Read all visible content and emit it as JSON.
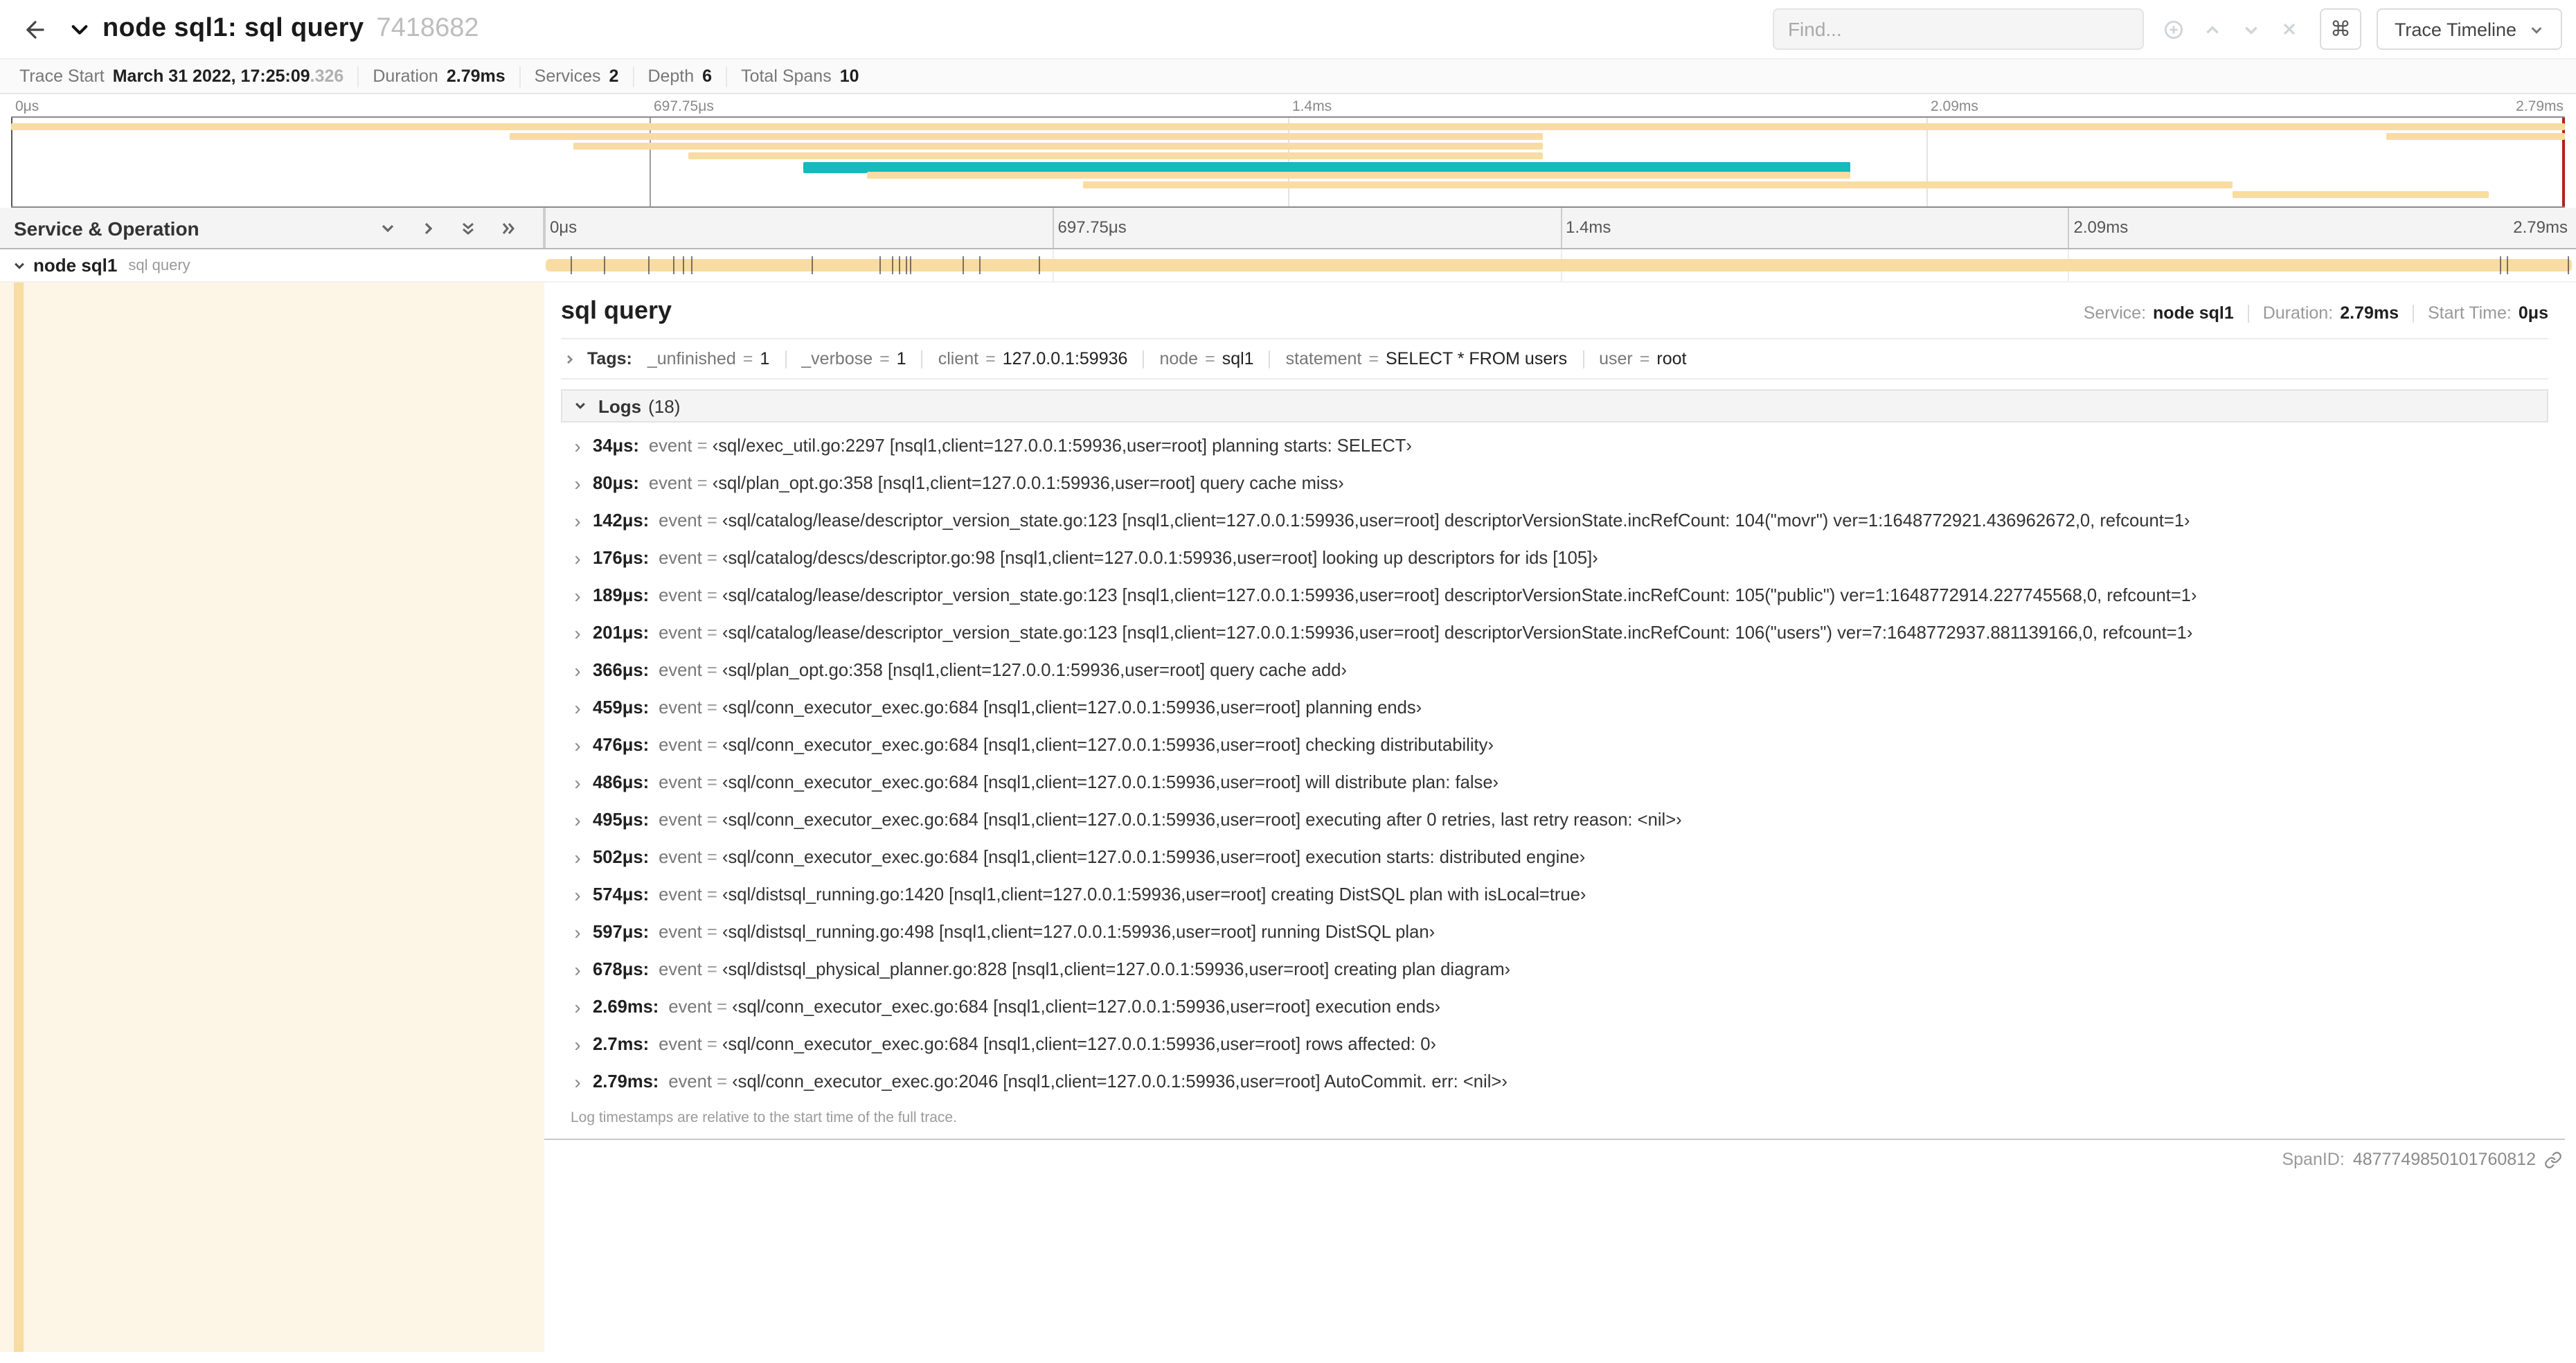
{
  "colors": {
    "tan": "#F8DCA1",
    "teal": "#17B8BE",
    "cursor_red": "#B32020"
  },
  "header": {
    "title": "node sql1: sql query",
    "trace_id": "7418682",
    "find_placeholder": "Find...",
    "shortcut_button": "⌘",
    "view_button": "Trace Timeline"
  },
  "info_bar": {
    "items": [
      {
        "label": "Trace Start",
        "value": "March 31 2022, 17:25:09",
        "suffix": ".326"
      },
      {
        "label": "Duration",
        "value": "2.79ms"
      },
      {
        "label": "Services",
        "value": "2"
      },
      {
        "label": "Depth",
        "value": "6"
      },
      {
        "label": "Total Spans",
        "value": "10"
      }
    ]
  },
  "timeline": {
    "left_header": "Service & Operation",
    "duration_us": 2790,
    "ticks": [
      {
        "label": "0μs",
        "pos": 0
      },
      {
        "label": "697.75μs",
        "pos": 25
      },
      {
        "label": "1.4ms",
        "pos": 50
      },
      {
        "label": "2.09ms",
        "pos": 75
      },
      {
        "label": "2.79ms",
        "pos": 100
      }
    ],
    "row": {
      "service": "node sql1",
      "operation": "sql query"
    }
  },
  "minimap": {
    "bars": [
      {
        "r": 0,
        "s": 0,
        "e": 100,
        "c": "tan"
      },
      {
        "r": 1,
        "s": 19.5,
        "e": 60,
        "c": "tan"
      },
      {
        "r": 1,
        "s": 93,
        "e": 100,
        "c": "tan"
      },
      {
        "r": 2,
        "s": 22,
        "e": 60,
        "c": "tan"
      },
      {
        "r": 3,
        "s": 26.5,
        "e": 60,
        "c": "tan"
      },
      {
        "r": 4,
        "s": 31,
        "e": 72,
        "c": "teal",
        "h": 8
      },
      {
        "r": 5,
        "s": 33.5,
        "e": 72,
        "c": "tan"
      },
      {
        "r": 6,
        "s": 42,
        "e": 87,
        "c": "tan"
      },
      {
        "r": 7,
        "s": 87,
        "e": 97,
        "c": "tan"
      }
    ]
  },
  "detail": {
    "title": "sql query",
    "meta": [
      {
        "label": "Service:",
        "value": "node sql1"
      },
      {
        "label": "Duration:",
        "value": "2.79ms"
      },
      {
        "label": "Start Time:",
        "value": "0μs"
      }
    ],
    "tags_label": "Tags:",
    "tags": [
      {
        "key": "_unfinished",
        "value": "1"
      },
      {
        "key": "_verbose",
        "value": "1"
      },
      {
        "key": "client",
        "value": "127.0.0.1:59936"
      },
      {
        "key": "node",
        "value": "sql1"
      },
      {
        "key": "statement",
        "value": "SELECT * FROM users"
      },
      {
        "key": "user",
        "value": "root"
      }
    ],
    "logs_label": "Logs",
    "logs_count": "(18)",
    "log_key": "event",
    "logs": [
      {
        "time": "34μs:",
        "us": 34,
        "value": "‹sql/exec_util.go:2297 [nsql1,client=127.0.0.1:59936,user=root] planning starts: SELECT›"
      },
      {
        "time": "80μs:",
        "us": 80,
        "value": "‹sql/plan_opt.go:358 [nsql1,client=127.0.0.1:59936,user=root] query cache miss›"
      },
      {
        "time": "142μs:",
        "us": 142,
        "value": "‹sql/catalog/lease/descriptor_version_state.go:123 [nsql1,client=127.0.0.1:59936,user=root] descriptorVersionState.incRefCount: 104(\"movr\") ver=1:1648772921.436962672,0, refcount=1›"
      },
      {
        "time": "176μs:",
        "us": 176,
        "value": "‹sql/catalog/descs/descriptor.go:98 [nsql1,client=127.0.0.1:59936,user=root] looking up descriptors for ids [105]›"
      },
      {
        "time": "189μs:",
        "us": 189,
        "value": "‹sql/catalog/lease/descriptor_version_state.go:123 [nsql1,client=127.0.0.1:59936,user=root] descriptorVersionState.incRefCount: 105(\"public\") ver=1:1648772914.227745568,0, refcount=1›"
      },
      {
        "time": "201μs:",
        "us": 201,
        "value": "‹sql/catalog/lease/descriptor_version_state.go:123 [nsql1,client=127.0.0.1:59936,user=root] descriptorVersionState.incRefCount: 106(\"users\") ver=7:1648772937.881139166,0, refcount=1›"
      },
      {
        "time": "366μs:",
        "us": 366,
        "value": "‹sql/plan_opt.go:358 [nsql1,client=127.0.0.1:59936,user=root] query cache add›"
      },
      {
        "time": "459μs:",
        "us": 459,
        "value": "‹sql/conn_executor_exec.go:684 [nsql1,client=127.0.0.1:59936,user=root] planning ends›"
      },
      {
        "time": "476μs:",
        "us": 476,
        "value": "‹sql/conn_executor_exec.go:684 [nsql1,client=127.0.0.1:59936,user=root] checking distributability›"
      },
      {
        "time": "486μs:",
        "us": 486,
        "value": "‹sql/conn_executor_exec.go:684 [nsql1,client=127.0.0.1:59936,user=root] will distribute plan: false›"
      },
      {
        "time": "495μs:",
        "us": 495,
        "value": "‹sql/conn_executor_exec.go:684 [nsql1,client=127.0.0.1:59936,user=root] executing after 0 retries, last retry reason: <nil>›"
      },
      {
        "time": "502μs:",
        "us": 502,
        "value": "‹sql/conn_executor_exec.go:684 [nsql1,client=127.0.0.1:59936,user=root] execution starts: distributed engine›"
      },
      {
        "time": "574μs:",
        "us": 574,
        "value": "‹sql/distsql_running.go:1420 [nsql1,client=127.0.0.1:59936,user=root] creating DistSQL plan with isLocal=true›"
      },
      {
        "time": "597μs:",
        "us": 597,
        "value": "‹sql/distsql_running.go:498 [nsql1,client=127.0.0.1:59936,user=root] running DistSQL plan›"
      },
      {
        "time": "678μs:",
        "us": 678,
        "value": "‹sql/distsql_physical_planner.go:828 [nsql1,client=127.0.0.1:59936,user=root] creating plan diagram›"
      },
      {
        "time": "2.69ms:",
        "us": 2690,
        "value": "‹sql/conn_executor_exec.go:684 [nsql1,client=127.0.0.1:59936,user=root] execution ends›"
      },
      {
        "time": "2.7ms:",
        "us": 2700,
        "value": "‹sql/conn_executor_exec.go:684 [nsql1,client=127.0.0.1:59936,user=root] rows affected: 0›"
      },
      {
        "time": "2.79ms:",
        "us": 2790,
        "value": "‹sql/conn_executor_exec.go:2046 [nsql1,client=127.0.0.1:59936,user=root] AutoCommit. err: <nil>›"
      }
    ],
    "footnote": "Log timestamps are relative to the start time of the full trace.",
    "spanid_label": "SpanID:",
    "spanid": "4877749850101760812"
  }
}
